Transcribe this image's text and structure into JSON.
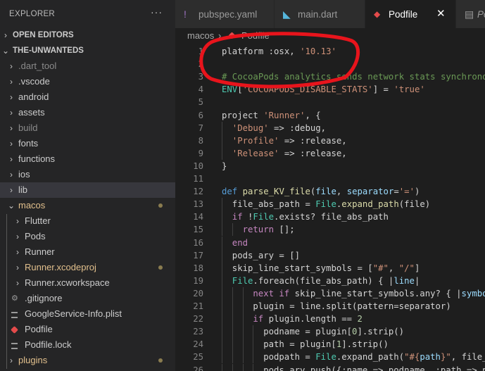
{
  "sidebar": {
    "title": "EXPLORER",
    "more": "···",
    "rows": [
      {
        "label": "OPEN EDITORS",
        "chev": "›",
        "indent": 0,
        "type": "section",
        "color": "#cccccc"
      },
      {
        "label": "THE-UNWANTEDS",
        "chev": "⌄",
        "indent": 0,
        "type": "section",
        "color": "#cccccc"
      },
      {
        "label": ".dart_tool",
        "chev": "›",
        "indent": 1,
        "color": "#8b8b8b"
      },
      {
        "label": ".vscode",
        "chev": "›",
        "indent": 1,
        "color": "#cccccc"
      },
      {
        "label": "android",
        "chev": "›",
        "indent": 1,
        "color": "#cccccc"
      },
      {
        "label": "assets",
        "chev": "›",
        "indent": 1,
        "color": "#cccccc"
      },
      {
        "label": "build",
        "chev": "›",
        "indent": 1,
        "color": "#8b8b8b"
      },
      {
        "label": "fonts",
        "chev": "›",
        "indent": 1,
        "color": "#cccccc"
      },
      {
        "label": "functions",
        "chev": "›",
        "indent": 1,
        "color": "#cccccc"
      },
      {
        "label": "ios",
        "chev": "›",
        "indent": 1,
        "color": "#cccccc"
      },
      {
        "label": "lib",
        "chev": "›",
        "indent": 1,
        "color": "#cccccc",
        "selected": true
      },
      {
        "label": "macos",
        "chev": "⌄",
        "indent": 1,
        "color": "#e2c08d",
        "dot": true
      },
      {
        "label": "Flutter",
        "chev": "›",
        "indent": 2,
        "color": "#cccccc"
      },
      {
        "label": "Pods",
        "chev": "›",
        "indent": 2,
        "color": "#cccccc"
      },
      {
        "label": "Runner",
        "chev": "›",
        "indent": 2,
        "color": "#cccccc"
      },
      {
        "label": "Runner.xcodeproj",
        "chev": "›",
        "indent": 2,
        "color": "#e2c08d",
        "dot": true
      },
      {
        "label": "Runner.xcworkspace",
        "chev": "›",
        "indent": 2,
        "color": "#cccccc"
      },
      {
        "label": ".gitignore",
        "icon": "gear",
        "indent": 2,
        "color": "#cccccc"
      },
      {
        "label": "GoogleService-Info.plist",
        "icon": "lines",
        "indent": 2,
        "color": "#cccccc"
      },
      {
        "label": "Podfile",
        "icon": "ruby",
        "indent": 2,
        "color": "#cccccc"
      },
      {
        "label": "Podfile.lock",
        "icon": "lines",
        "indent": 2,
        "color": "#cccccc"
      },
      {
        "label": "plugins",
        "chev": "›",
        "indent": 1,
        "color": "#e2c08d",
        "dot": true
      }
    ]
  },
  "tabs": [
    {
      "label": "pubspec.yaml",
      "icon": "!",
      "icon_color": "#a074c4",
      "active": false,
      "italic": false
    },
    {
      "label": "main.dart",
      "icon": "◣",
      "icon_color": "#55b5db",
      "active": false,
      "italic": false
    },
    {
      "label": "Podfile",
      "icon": "◆",
      "icon_color": "#e44b4b",
      "active": true,
      "italic": false,
      "close": "✕"
    },
    {
      "label": "Pod",
      "icon": "▤",
      "icon_color": "#9a9a9a",
      "active": false,
      "italic": true
    }
  ],
  "breadcrumb": {
    "folder": "macos",
    "sep": "›",
    "file": "Podfile"
  },
  "annotation_color": "#e8141c",
  "code": {
    "lines": [
      {
        "n": "1",
        "indent": 0,
        "tokens": [
          [
            "p",
            "platform :osx, "
          ],
          [
            "s",
            "'10.13'"
          ]
        ]
      },
      {
        "n": "2",
        "indent": 0,
        "tokens": []
      },
      {
        "n": "3",
        "indent": 0,
        "tokens": [
          [
            "c",
            "# CocoaPods analytics sends network stats synchronou"
          ]
        ]
      },
      {
        "n": "4",
        "indent": 0,
        "tokens": [
          [
            "t",
            "ENV"
          ],
          [
            "p",
            "["
          ],
          [
            "s",
            "'COCOAPODS_DISABLE_STATS'"
          ],
          [
            "p",
            "] = "
          ],
          [
            "s",
            "'true'"
          ]
        ]
      },
      {
        "n": "5",
        "indent": 0,
        "tokens": []
      },
      {
        "n": "6",
        "indent": 0,
        "tokens": [
          [
            "p",
            "project "
          ],
          [
            "s",
            "'Runner'"
          ],
          [
            "p",
            ", {"
          ]
        ]
      },
      {
        "n": "7",
        "indent": 1,
        "tokens": [
          [
            "s",
            "'Debug'"
          ],
          [
            "p",
            " => :debug,"
          ]
        ]
      },
      {
        "n": "8",
        "indent": 1,
        "tokens": [
          [
            "s",
            "'Profile'"
          ],
          [
            "p",
            " => :release,"
          ]
        ]
      },
      {
        "n": "9",
        "indent": 1,
        "tokens": [
          [
            "s",
            "'Release'"
          ],
          [
            "p",
            " => :release,"
          ]
        ]
      },
      {
        "n": "10",
        "indent": 0,
        "tokens": [
          [
            "p",
            "}"
          ]
        ]
      },
      {
        "n": "11",
        "indent": 0,
        "tokens": []
      },
      {
        "n": "12",
        "indent": 0,
        "tokens": [
          [
            "d",
            "def "
          ],
          [
            "f",
            "parse_KV_file"
          ],
          [
            "p",
            "("
          ],
          [
            "v",
            "file"
          ],
          [
            "p",
            ", "
          ],
          [
            "v",
            "separator"
          ],
          [
            "p",
            "="
          ],
          [
            "s",
            "'='"
          ],
          [
            "p",
            ")"
          ]
        ]
      },
      {
        "n": "13",
        "indent": 1,
        "tokens": [
          [
            "p",
            "file_abs_path = "
          ],
          [
            "t",
            "File"
          ],
          [
            "p",
            "."
          ],
          [
            "f",
            "expand_path"
          ],
          [
            "p",
            "(file)"
          ]
        ]
      },
      {
        "n": "14",
        "indent": 1,
        "tokens": [
          [
            "k",
            "if "
          ],
          [
            "p",
            "!"
          ],
          [
            "t",
            "File"
          ],
          [
            "p",
            ".exists? file_abs_path"
          ]
        ]
      },
      {
        "n": "15",
        "indent": 2,
        "tokens": [
          [
            "k",
            "return "
          ],
          [
            "p",
            "[];"
          ]
        ]
      },
      {
        "n": "16",
        "indent": 1,
        "tokens": [
          [
            "k",
            "end"
          ]
        ]
      },
      {
        "n": "17",
        "indent": 1,
        "tokens": [
          [
            "p",
            "pods_ary = []"
          ]
        ]
      },
      {
        "n": "18",
        "indent": 1,
        "tokens": [
          [
            "p",
            "skip_line_start_symbols = ["
          ],
          [
            "s",
            "\"#\""
          ],
          [
            "p",
            ", "
          ],
          [
            "s",
            "\"/\""
          ],
          [
            "p",
            "]"
          ]
        ]
      },
      {
        "n": "19",
        "indent": 1,
        "tokens": [
          [
            "t",
            "File"
          ],
          [
            "p",
            ".foreach(file_abs_path) { |"
          ],
          [
            "v",
            "line"
          ],
          [
            "p",
            "|"
          ]
        ]
      },
      {
        "n": "20",
        "indent": 3,
        "tokens": [
          [
            "k",
            "next if "
          ],
          [
            "p",
            "skip_line_start_symbols.any? { |"
          ],
          [
            "v",
            "symbol"
          ]
        ]
      },
      {
        "n": "21",
        "indent": 3,
        "tokens": [
          [
            "p",
            "plugin = line.split(pattern=separator)"
          ]
        ]
      },
      {
        "n": "22",
        "indent": 3,
        "tokens": [
          [
            "k",
            "if "
          ],
          [
            "p",
            "plugin.length == "
          ],
          [
            "n",
            "2"
          ]
        ]
      },
      {
        "n": "23",
        "indent": 4,
        "tokens": [
          [
            "p",
            "podname = plugin["
          ],
          [
            "n",
            "0"
          ],
          [
            "p",
            "].strip()"
          ]
        ]
      },
      {
        "n": "24",
        "indent": 4,
        "tokens": [
          [
            "p",
            "path = plugin["
          ],
          [
            "n",
            "1"
          ],
          [
            "p",
            "].strip()"
          ]
        ]
      },
      {
        "n": "25",
        "indent": 4,
        "tokens": [
          [
            "p",
            "podpath = "
          ],
          [
            "t",
            "File"
          ],
          [
            "p",
            ".expand_path("
          ],
          [
            "s",
            "\"#{"
          ],
          [
            "v",
            "path"
          ],
          [
            "s",
            "}\""
          ],
          [
            "p",
            ", file_a"
          ]
        ]
      },
      {
        "n": "26",
        "indent": 4,
        "tokens": [
          [
            "p",
            "pods_ary.push({:name => podname, :path => po"
          ]
        ]
      }
    ]
  }
}
